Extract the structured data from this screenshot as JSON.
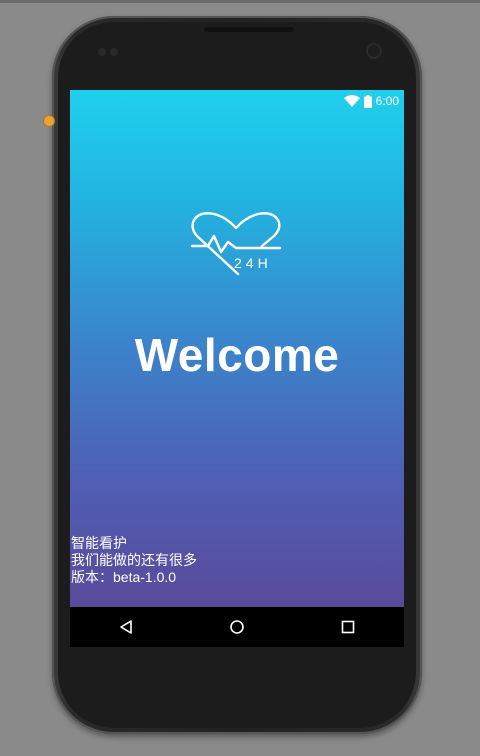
{
  "status_bar": {
    "time": "6:00",
    "icons": [
      "wifi-icon",
      "battery-icon"
    ]
  },
  "splash": {
    "logo_icon": "heart-pulse-24h-icon",
    "logo_text": "24H",
    "title": "Welcome",
    "tagline_1": "智能看护",
    "tagline_2": "我们能做的还有很多",
    "version": "版本：beta-1.0.0"
  },
  "nav_bar": {
    "buttons": [
      "back-icon",
      "home-icon",
      "recents-icon"
    ]
  },
  "colors": {
    "gradient_top": "#1fd0ec",
    "gradient_bottom": "#5a4a9a",
    "text": "#ffffff",
    "navbar": "#000000"
  }
}
